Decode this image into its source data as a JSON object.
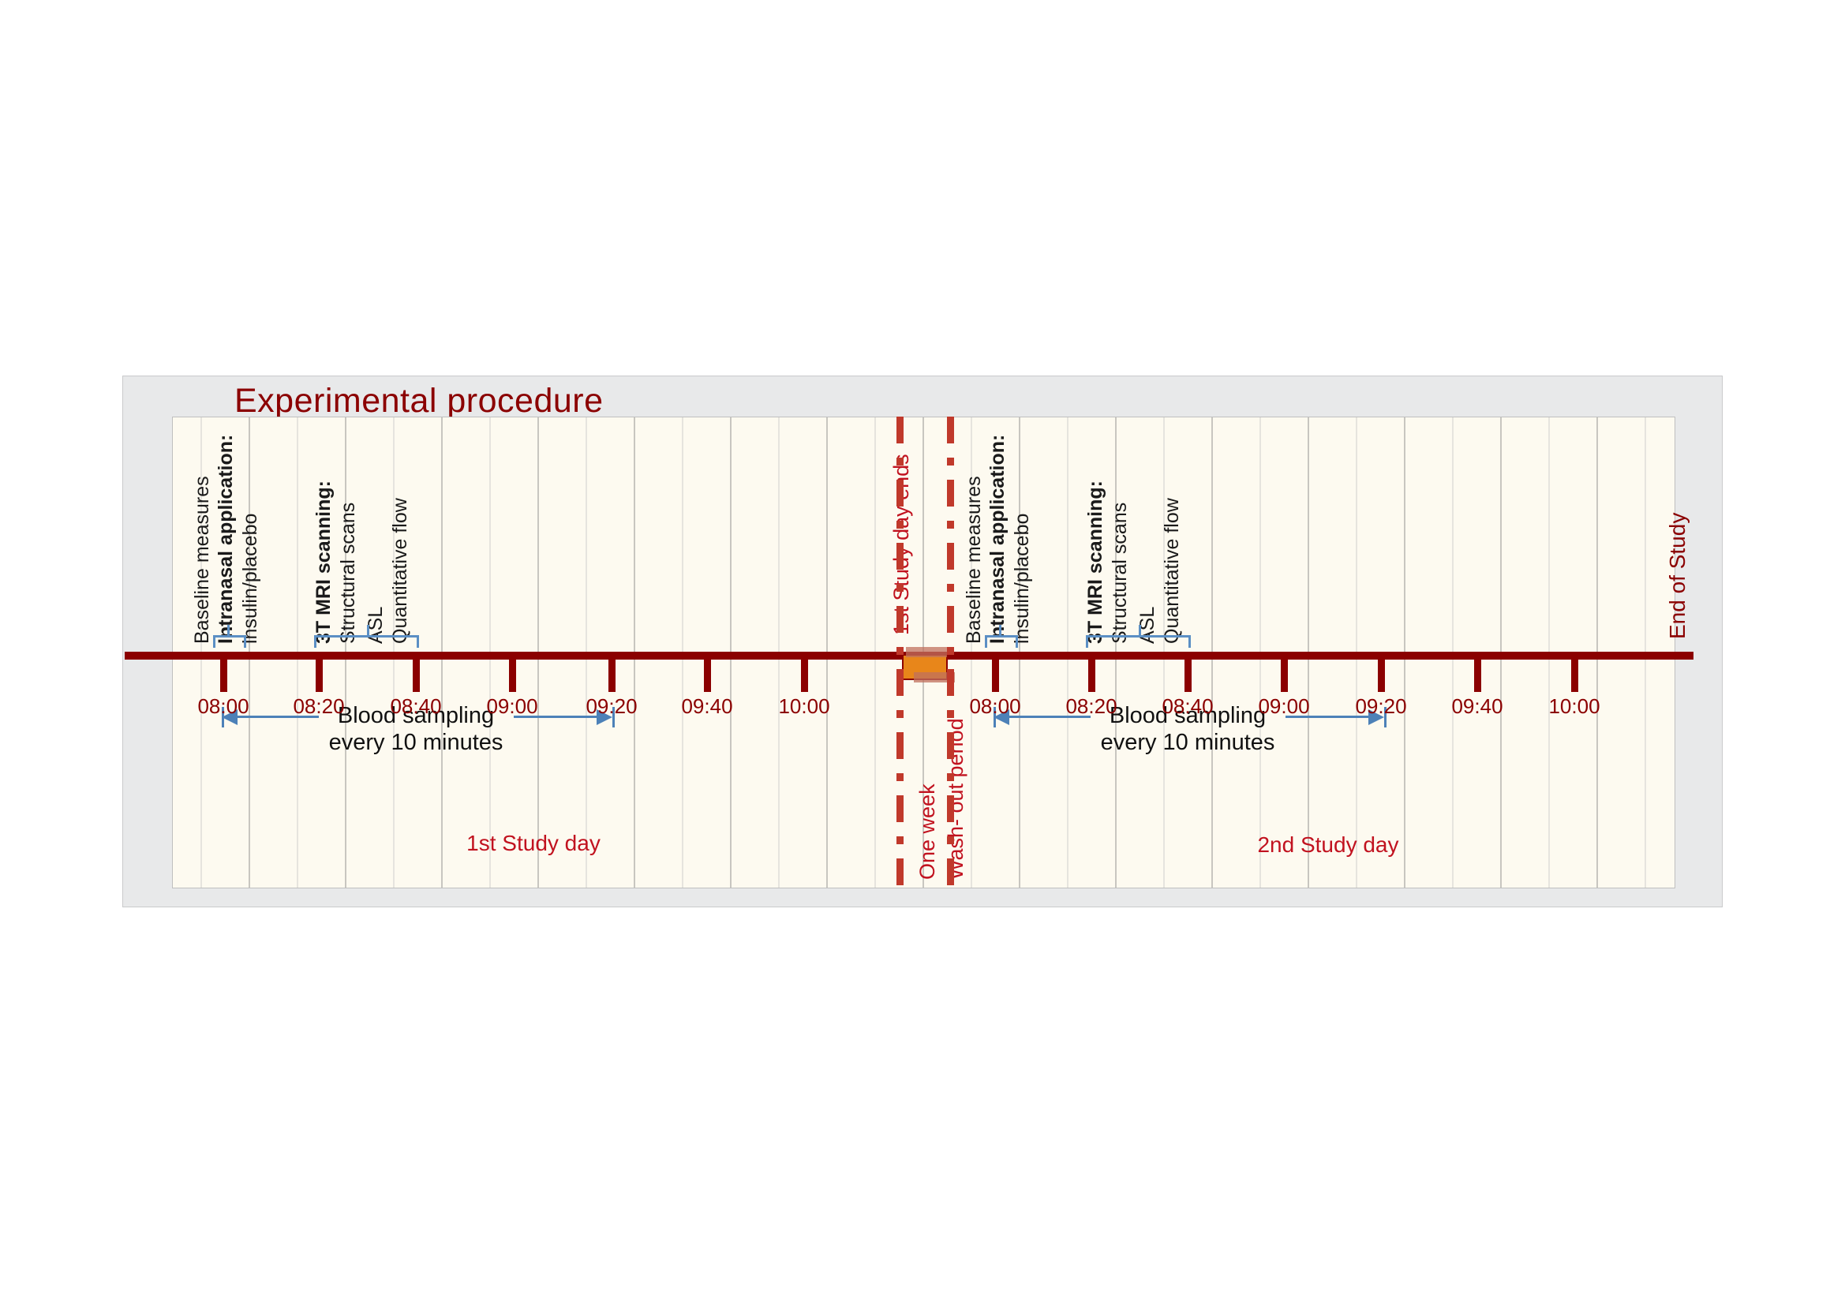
{
  "chart_data": {
    "type": "timeline",
    "title": "Experimental procedure",
    "xlabel": "",
    "ylabel": "",
    "grid": true,
    "legend_position": "none",
    "axis_color": "#8B0000",
    "accent_blue": "#4d81b8",
    "accent_red": "#c1121f",
    "highlight_orange": "#e8861a",
    "panel_background": "#fdfaf0",
    "frame_background": "#e8e9ea",
    "days": [
      {
        "name": "1st Study day",
        "tick_labels": [
          "08:00",
          "08:20",
          "08:40",
          "09:00",
          "09:20",
          "09:40",
          "10:00"
        ],
        "tick_x": [
          283,
          404,
          527,
          649,
          775,
          896,
          1019
        ],
        "events": [
          {
            "label": "Baseline measures",
            "bold": false
          },
          {
            "label": "Intranasal application:",
            "bold": true
          },
          {
            "label": "insulin/placebo",
            "bold": false
          },
          {
            "label": "3T MRI scanning:",
            "bold": true
          },
          {
            "label": "Structural scans",
            "bold": false
          },
          {
            "label": "ASL",
            "bold": false
          },
          {
            "label": "Quantitative flow",
            "bold": false
          }
        ],
        "blood_sampling": {
          "line1": "Blood sampling",
          "line2": "every 10 minutes",
          "from": "08:00",
          "to": "09:20"
        }
      },
      {
        "name": "2nd Study day",
        "tick_labels": [
          "08:00",
          "08:20",
          "08:40",
          "09:00",
          "09:20",
          "09:40",
          "10:00"
        ],
        "tick_x": [
          1261,
          1383,
          1505,
          1627,
          1750,
          1872,
          1995
        ],
        "events": [
          {
            "label": "Baseline measures",
            "bold": false
          },
          {
            "label": "Intranasal application:",
            "bold": true
          },
          {
            "label": "insulin/placebo",
            "bold": false
          },
          {
            "label": "3T MRI scanning:",
            "bold": true
          },
          {
            "label": "Structural scans",
            "bold": false
          },
          {
            "label": "ASL",
            "bold": false
          },
          {
            "label": "Quantitative flow",
            "bold": false
          }
        ],
        "blood_sampling": {
          "line1": "Blood sampling",
          "line2": "every 10 minutes",
          "from": "08:00",
          "to": "09:20"
        }
      }
    ],
    "markers": [
      {
        "label": "1st Study day ends",
        "color": "#c1121f"
      },
      {
        "label": "One week",
        "color": "#c1121f"
      },
      {
        "label": "Wash- out period",
        "color": "#c1121f"
      },
      {
        "label": "End of Study",
        "color": "#8B0000"
      }
    ]
  },
  "title": "Experimental procedure",
  "day1": {
    "label_baseline": "Baseline measures",
    "label_intranasal": "Intranasal application:",
    "label_insulin": "insulin/placebo",
    "label_mri": "3T MRI scanning:",
    "label_structural": "Structural scans",
    "label_asl": "ASL",
    "label_flow": "Quantitative flow",
    "sampling_line1": "Blood sampling",
    "sampling_line2": "every 10 minutes",
    "caption": "1st Study day",
    "t1": "08:00",
    "t2": "08:20",
    "t3": "08:40",
    "t4": "09:00",
    "t5": "09:20",
    "t6": "09:40",
    "t7": "10:00"
  },
  "day2": {
    "label_baseline": "Baseline measures",
    "label_intranasal": "Intranasal application:",
    "label_insulin": "insulin/placebo",
    "label_mri": "3T MRI scanning:",
    "label_structural": "Structural scans",
    "label_asl": "ASL",
    "label_flow": "Quantitative flow",
    "sampling_line1": "Blood sampling",
    "sampling_line2": "every 10 minutes",
    "caption": "2nd Study day",
    "t1": "08:00",
    "t2": "08:20",
    "t3": "08:40",
    "t4": "09:00",
    "t5": "09:20",
    "t6": "09:40",
    "t7": "10:00"
  },
  "washout": {
    "day_ends": "1st Study day ends",
    "one_week": "One week",
    "period": "Wash- out period"
  },
  "end": {
    "label": "End of Study"
  }
}
